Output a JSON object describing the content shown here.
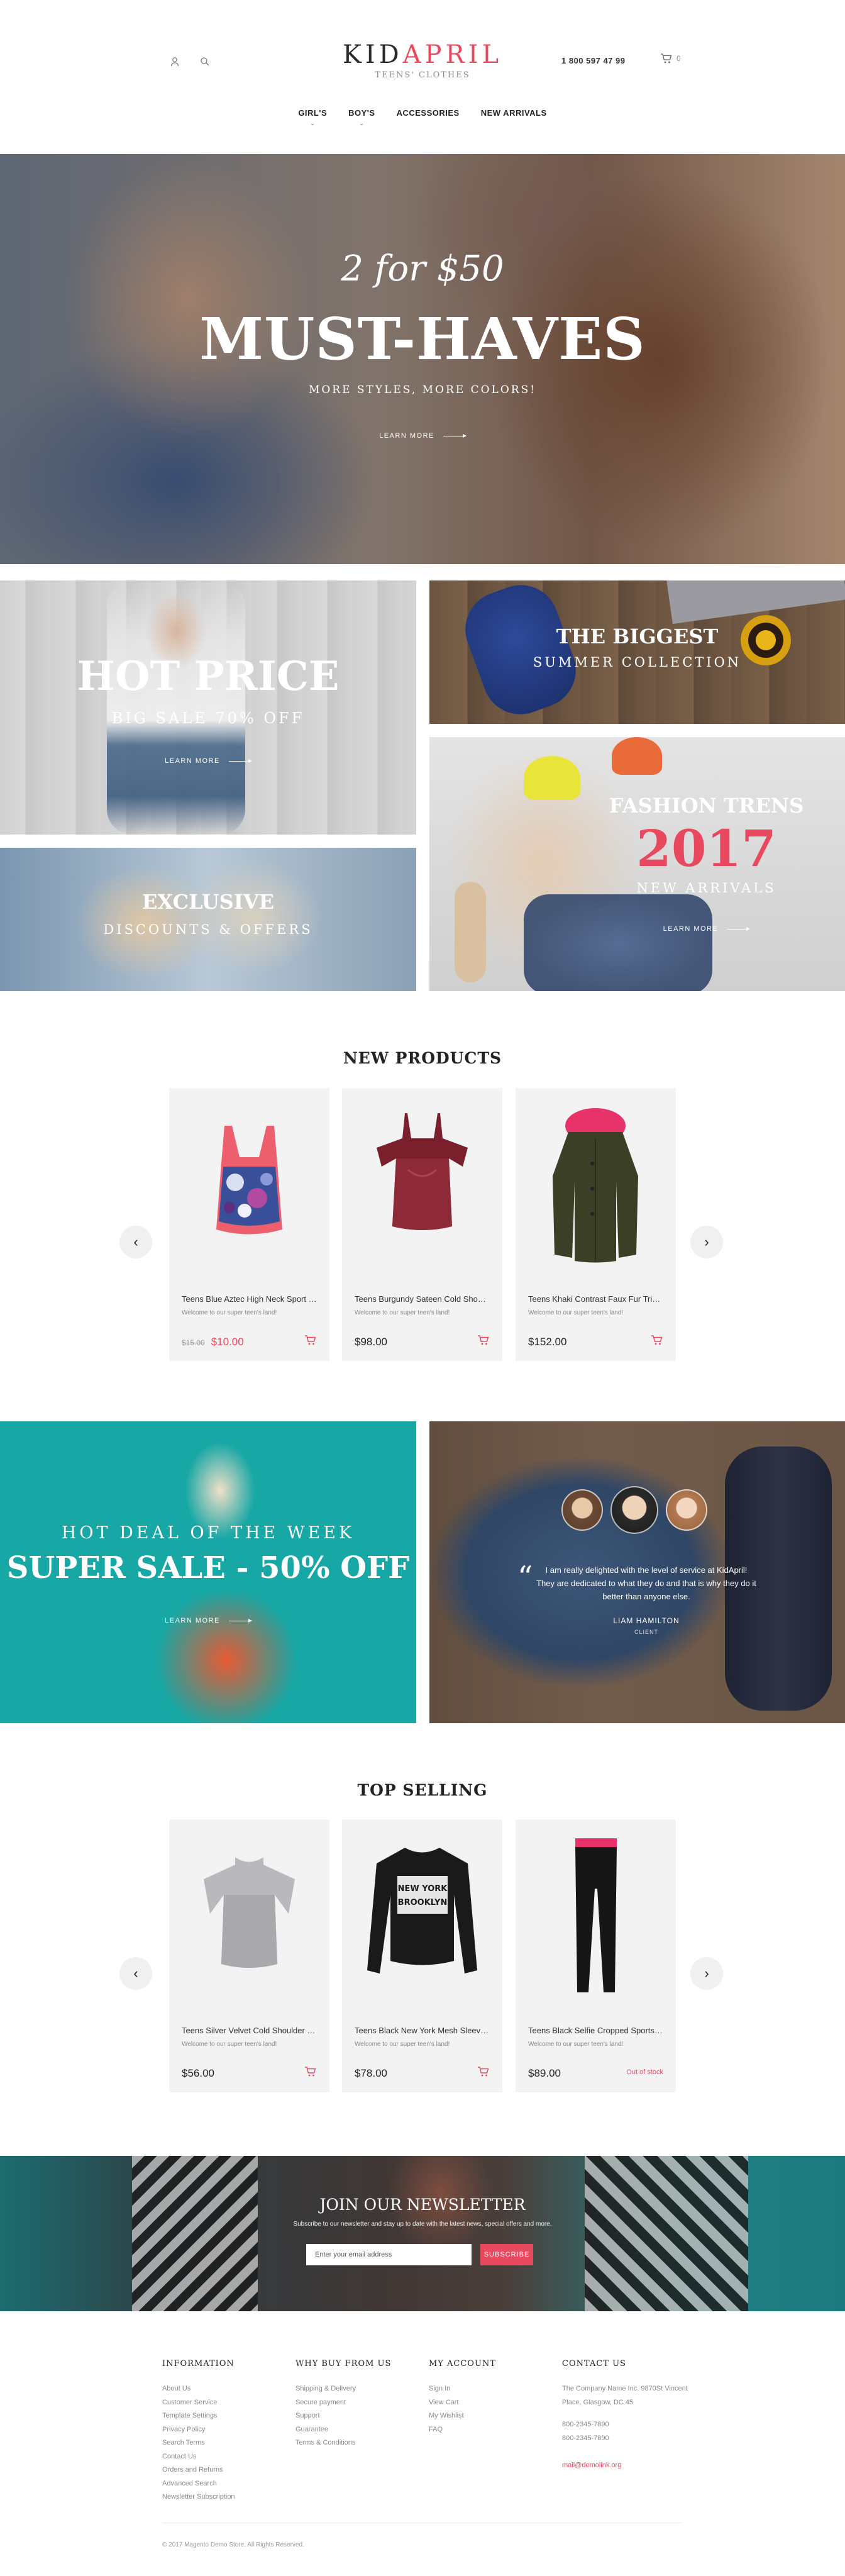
{
  "header": {
    "logo_part1": "KID",
    "logo_part2": "APRIL",
    "logo_sub": "TEENS' CLOTHES",
    "phone": "1 800 597 47 99",
    "cart_count": "0",
    "icons": [
      "user-icon",
      "search-icon",
      "cart-icon"
    ],
    "nav": [
      "GIRL'S",
      "BOY'S",
      "ACCESSORIES",
      "NEW ARRIVALS"
    ]
  },
  "hero": {
    "script": "2 for $50",
    "title": "MUST-HAVES",
    "subtitle": "MORE STYLES, MORE COLORS!",
    "cta": "LEARN MORE"
  },
  "banners": {
    "hot": {
      "title": "HOT PRICE",
      "subtitle": "BIG SALE 70% OFF",
      "cta": "LEARN MORE"
    },
    "biggest": {
      "title": "THE BIGGEST",
      "subtitle": "SUMMER COLLECTION"
    },
    "fashion": {
      "title": "FASHION TRENS",
      "year": "2017",
      "subtitle": "NEW ARRIVALS",
      "cta": "LEARN MORE"
    },
    "exclusive": {
      "title": "EXCLUSIVE",
      "subtitle": "DISCOUNTS & OFFERS"
    }
  },
  "new_products": {
    "title": "NEW PRODUCTS",
    "items": [
      {
        "name": "Teens Blue Aztec High Neck Sport Bra",
        "desc": "Welcome to our super teen's land!",
        "old_price": "$15.00",
        "price": "$10.00"
      },
      {
        "name": "Teens Burgundy Sateen Cold Shoulder Top",
        "desc": "Welcome to our super teen's land!",
        "price": "$98.00"
      },
      {
        "name": "Teens Khaki Contrast Faux Fur Trim Parka",
        "desc": "Welcome to our super teen's land!",
        "price": "$152.00"
      }
    ]
  },
  "deal": {
    "line1": "HOT DEAL OF THE WEEK",
    "line2": "SUPER SALE - 50% OFF",
    "cta": "LEARN MORE"
  },
  "testimonial": {
    "quote": "I am really delighted with the level of service at KidApril! They are dedicated to what they do and that is why they do it better than anyone else.",
    "author": "LIAM HAMILTON",
    "role": "CLIENT"
  },
  "top_selling": {
    "title": "TOP SELLING",
    "items": [
      {
        "name": "Teens Silver Velvet Cold Shoulder Top",
        "desc": "Welcome to our super teen's land!",
        "price": "$56.00"
      },
      {
        "name": "Teens Black New York Mesh Sleeve Top",
        "desc": "Welcome to our super teen's land!",
        "price": "$78.00"
      },
      {
        "name": "Teens Black Selfie Cropped Sports Leggings",
        "desc": "Welcome to our super teen's land!",
        "price": "$89.00",
        "stock": "Out of stock"
      }
    ]
  },
  "newsletter": {
    "title": "JOIN OUR NEWSLETTER",
    "subtitle": "Subscribe to our newsletter and stay up to date with the latest news, special offers and more.",
    "placeholder": "Enter your email address",
    "button": "SUBSCRIBE"
  },
  "footer": {
    "information": {
      "title": "INFORMATION",
      "links": [
        "About Us",
        "Customer Service",
        "Template Settings",
        "Privacy Policy",
        "Search Terms",
        "Contact Us",
        "Orders and Returns",
        "Advanced Search",
        "Newsletter Subscription"
      ]
    },
    "why": {
      "title": "WHY BUY FROM US",
      "links": [
        "Shipping & Delivery",
        "Secure payment",
        "Support",
        "Guarantee",
        "Terms & Conditions"
      ]
    },
    "account": {
      "title": "MY ACCOUNT",
      "links": [
        "Sign In",
        "View Cart",
        "My Wishlist",
        "FAQ"
      ]
    },
    "contact": {
      "title": "CONTACT US",
      "address1": "The Company Name Inc. 9870St Vincent",
      "address2": "Place, Glasgow, DC 45",
      "phone1": "800-2345-7890",
      "phone2": "800-2345-7890",
      "email": "mail@demolink.org"
    },
    "copyright": "© 2017 Magento Demo Store. All Rights Reserved."
  }
}
